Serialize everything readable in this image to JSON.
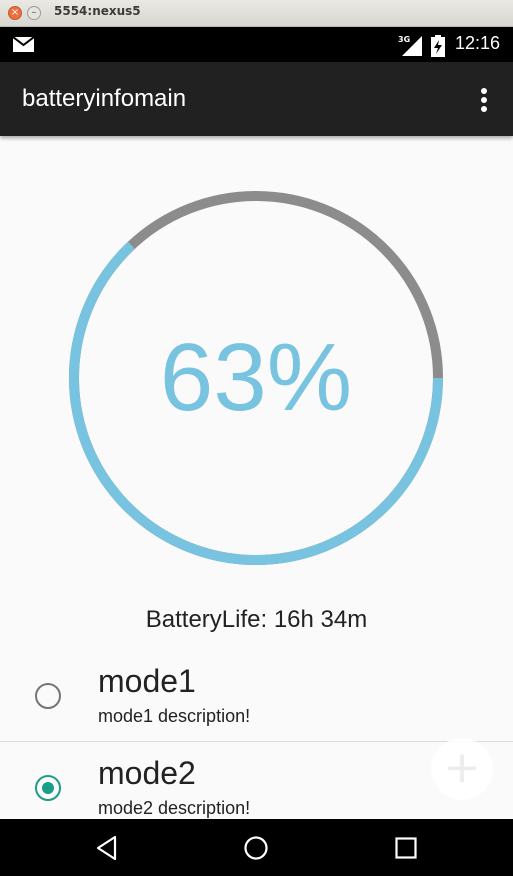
{
  "window": {
    "title": "5554:nexus5",
    "close_glyph": "×",
    "minimize_glyph": "–"
  },
  "status_bar": {
    "time": "12:16",
    "network": "3G",
    "icons": [
      "mail-icon",
      "signal-icon",
      "battery-charging-icon"
    ]
  },
  "app_bar": {
    "title": "batteryinfomain",
    "menu_icon": "overflow-menu-icon"
  },
  "gauge": {
    "percent_text": "63%",
    "level": 0.63,
    "fill_color": "#78c3df",
    "track_color": "#8c8c8c"
  },
  "battery_life": "BatteryLife: 16h 34m",
  "modes": [
    {
      "title": "mode1",
      "description": "mode1 description!",
      "selected": false
    },
    {
      "title": "mode2",
      "description": "mode2 description!",
      "selected": true
    }
  ],
  "fab": {
    "glyph": "+",
    "icon": "add-icon"
  },
  "nav_bar": {
    "icons": [
      "back-icon",
      "home-icon",
      "recents-icon"
    ]
  },
  "colors": {
    "accent": "#1a9e89",
    "app_bar": "#212121",
    "status_bar": "#000000",
    "background": "#fafafa"
  }
}
